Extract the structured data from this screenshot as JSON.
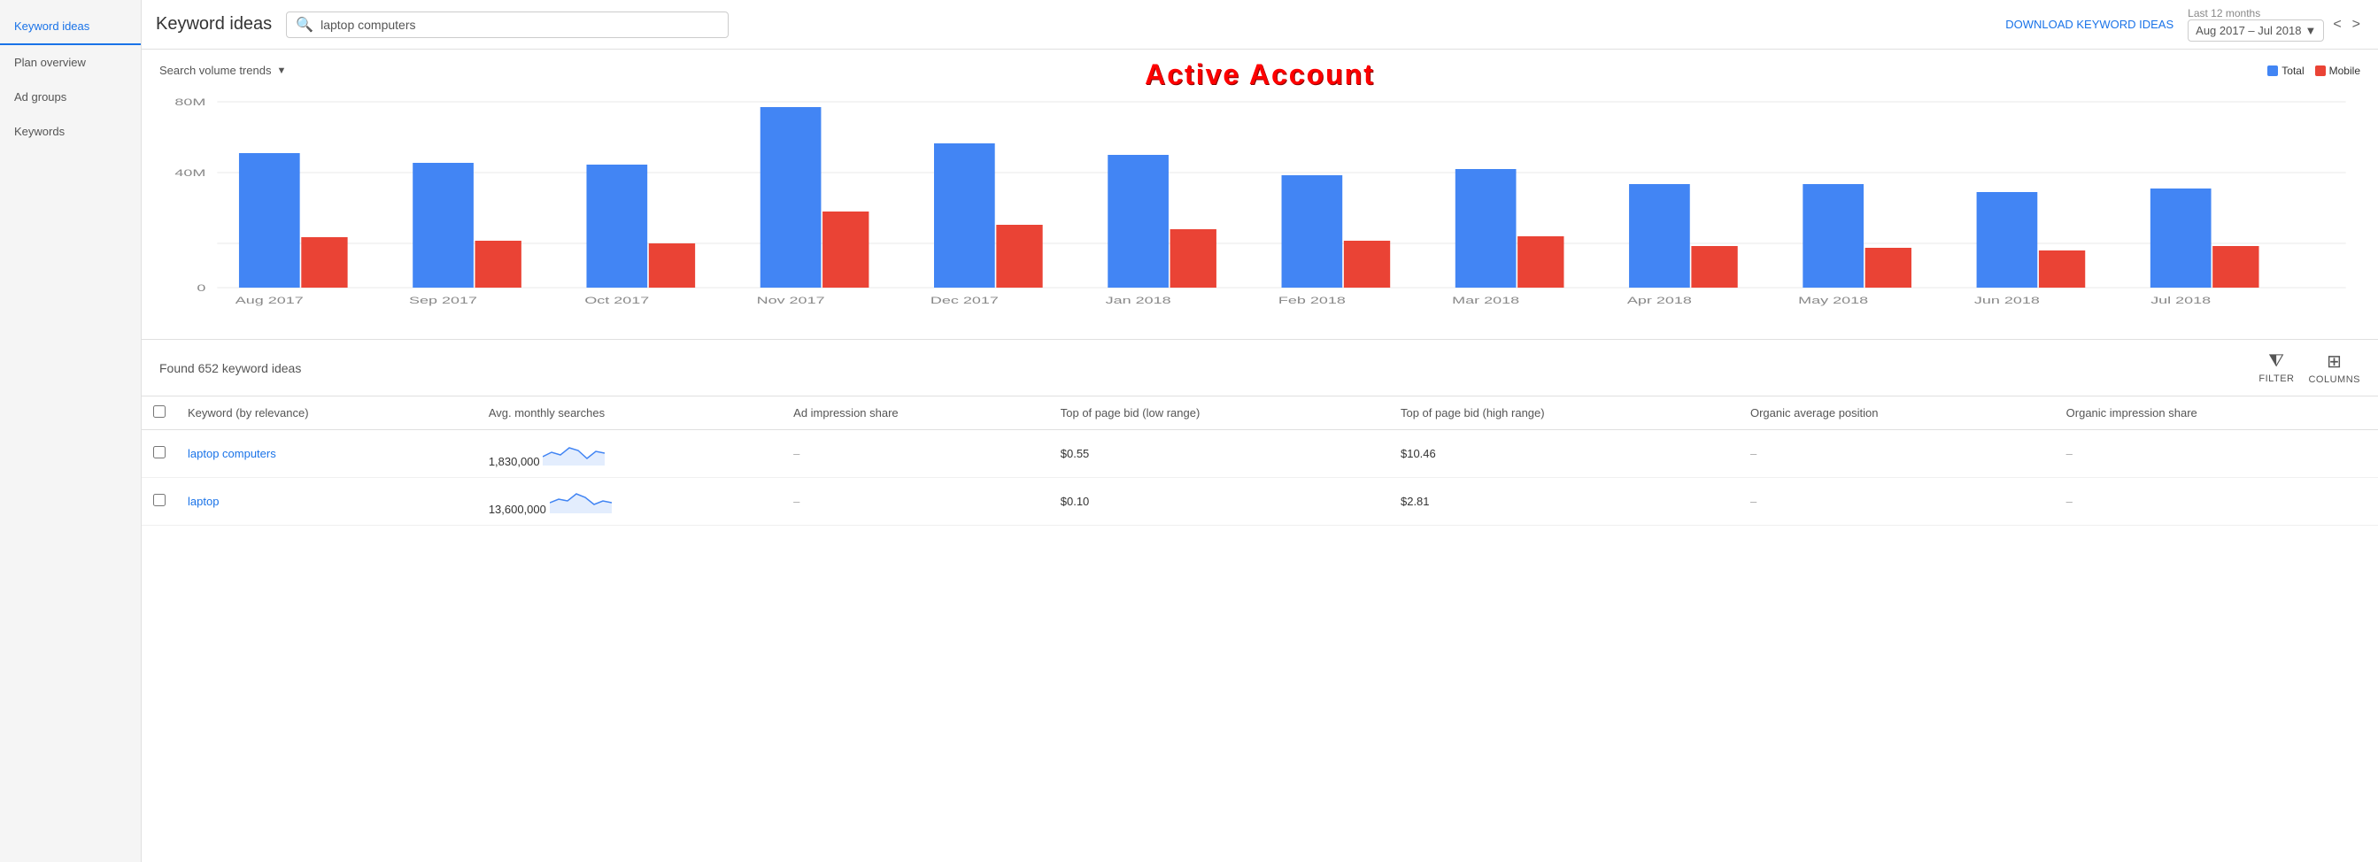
{
  "sidebar": {
    "items": [
      {
        "label": "Keyword ideas",
        "id": "keyword-ideas",
        "active": true
      },
      {
        "label": "Plan overview",
        "id": "plan-overview",
        "active": false
      },
      {
        "label": "Ad groups",
        "id": "ad-groups",
        "active": false
      },
      {
        "label": "Keywords",
        "id": "keywords",
        "active": false
      }
    ]
  },
  "header": {
    "title": "Keyword ideas",
    "search_placeholder": "laptop computers",
    "search_value": "laptop computers",
    "download_label": "DOWNLOAD KEYWORD IDEAS",
    "date_range_label": "Last 12 months",
    "date_range_value": "Aug 2017 – Jul 2018",
    "nav_prev": "<",
    "nav_next": ">"
  },
  "chart": {
    "title": "Search volume trends",
    "active_account_label": "Active Account",
    "legend": [
      {
        "label": "Total",
        "color": "#4285f4"
      },
      {
        "label": "Mobile",
        "color": "#ea4335"
      }
    ],
    "y_axis_labels": [
      "80M",
      "40M",
      "0"
    ],
    "months": [
      {
        "label": "Aug 2017",
        "total": 58,
        "mobile": 22
      },
      {
        "label": "Sep 2017",
        "total": 54,
        "mobile": 20
      },
      {
        "label": "Oct 2017",
        "total": 53,
        "mobile": 19
      },
      {
        "label": "Nov 2017",
        "total": 78,
        "mobile": 33
      },
      {
        "label": "Dec 2017",
        "total": 62,
        "mobile": 27
      },
      {
        "label": "Jan 2018",
        "total": 57,
        "mobile": 25
      },
      {
        "label": "Feb 2018",
        "total": 48,
        "mobile": 20
      },
      {
        "label": "Mar 2018",
        "total": 51,
        "mobile": 22
      },
      {
        "label": "Apr 2018",
        "total": 44,
        "mobile": 18
      },
      {
        "label": "May 2018",
        "total": 44,
        "mobile": 17
      },
      {
        "label": "Jun 2018",
        "total": 41,
        "mobile": 16
      },
      {
        "label": "Jul 2018",
        "total": 42,
        "mobile": 18
      }
    ]
  },
  "table": {
    "found_text": "Found 652 keyword ideas",
    "filter_label": "FILTER",
    "columns_label": "COLUMNS",
    "columns_headers": [
      "Keyword (by relevance)",
      "Avg. monthly searches",
      "Ad impression share",
      "Top of page bid (low range)",
      "Top of page bid (high range)",
      "Organic average position",
      "Organic impression share"
    ],
    "rows": [
      {
        "keyword": "laptop computers",
        "avg_monthly": "1,830,000",
        "ad_impression": "–",
        "top_bid_low": "$0.55",
        "top_bid_high": "$10.46",
        "organic_avg": "–",
        "organic_impression": "–"
      },
      {
        "keyword": "laptop",
        "avg_monthly": "13,600,000",
        "ad_impression": "–",
        "top_bid_low": "$0.10",
        "top_bid_high": "$2.81",
        "organic_avg": "–",
        "organic_impression": "–"
      }
    ]
  }
}
